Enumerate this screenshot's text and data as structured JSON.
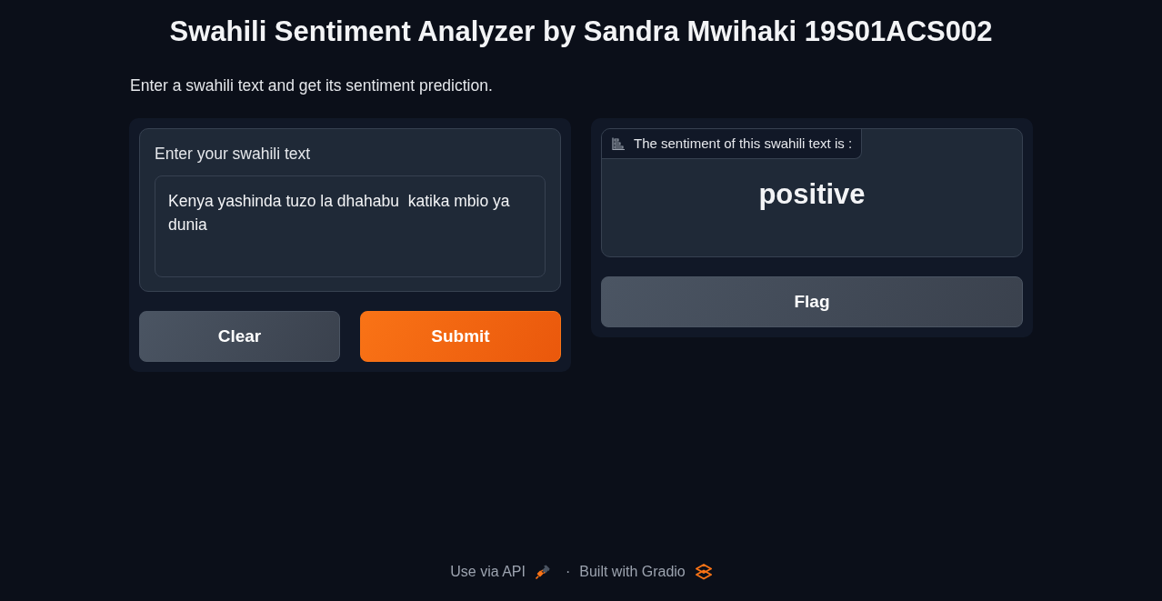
{
  "title": "Swahili Sentiment Analyzer by Sandra Mwihaki 19S01ACS002",
  "description": "Enter a swahili text and get its sentiment prediction.",
  "input_panel": {
    "label": "Enter your swahili text",
    "textbox": {
      "value": "Kenya yashinda tuzo la dhahabu  katika mbio ya dunia"
    },
    "buttons": [
      {
        "label": "Clear",
        "kind": "secondary"
      },
      {
        "label": "Submit",
        "kind": "primary"
      }
    ]
  },
  "output_panel": {
    "label": "The sentiment of this swahili text is :",
    "value": "positive",
    "buttons": [
      {
        "label": "Flag",
        "kind": "secondary"
      }
    ]
  },
  "footer": {
    "links": [
      {
        "label": "Use via API",
        "kind": "api"
      },
      {
        "label": "Built with Gradio",
        "kind": "gradio"
      }
    ],
    "separator": "·"
  }
}
